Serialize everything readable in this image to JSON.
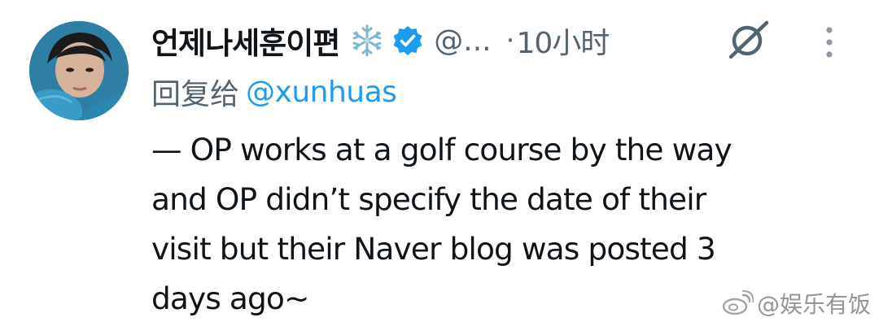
{
  "tweet": {
    "display_name": "언제나세훈이편",
    "handle": "@...",
    "separator": "·",
    "time": "10小时",
    "reply_prefix": "回复给",
    "reply_mention": "@xunhuas",
    "text_lines": [
      "— OP works at a golf course by the way",
      "and OP didn’t specify the date of their",
      "visit but their Naver blog was posted 3",
      "days ago~"
    ]
  },
  "icons": {
    "name_emoji": "snowflake-icon",
    "verified": "verified-badge-icon",
    "grok": "grok-icon",
    "more": "more-vertical-icon"
  },
  "watermark": {
    "text": "@娱乐有饭",
    "logo": "weibo-logo-icon"
  },
  "colors": {
    "name": "#0f1419",
    "secondary": "#536471",
    "mention": "#1d9bf0",
    "verified": "#1d9bf0",
    "watermark": "#8a8a8a"
  }
}
